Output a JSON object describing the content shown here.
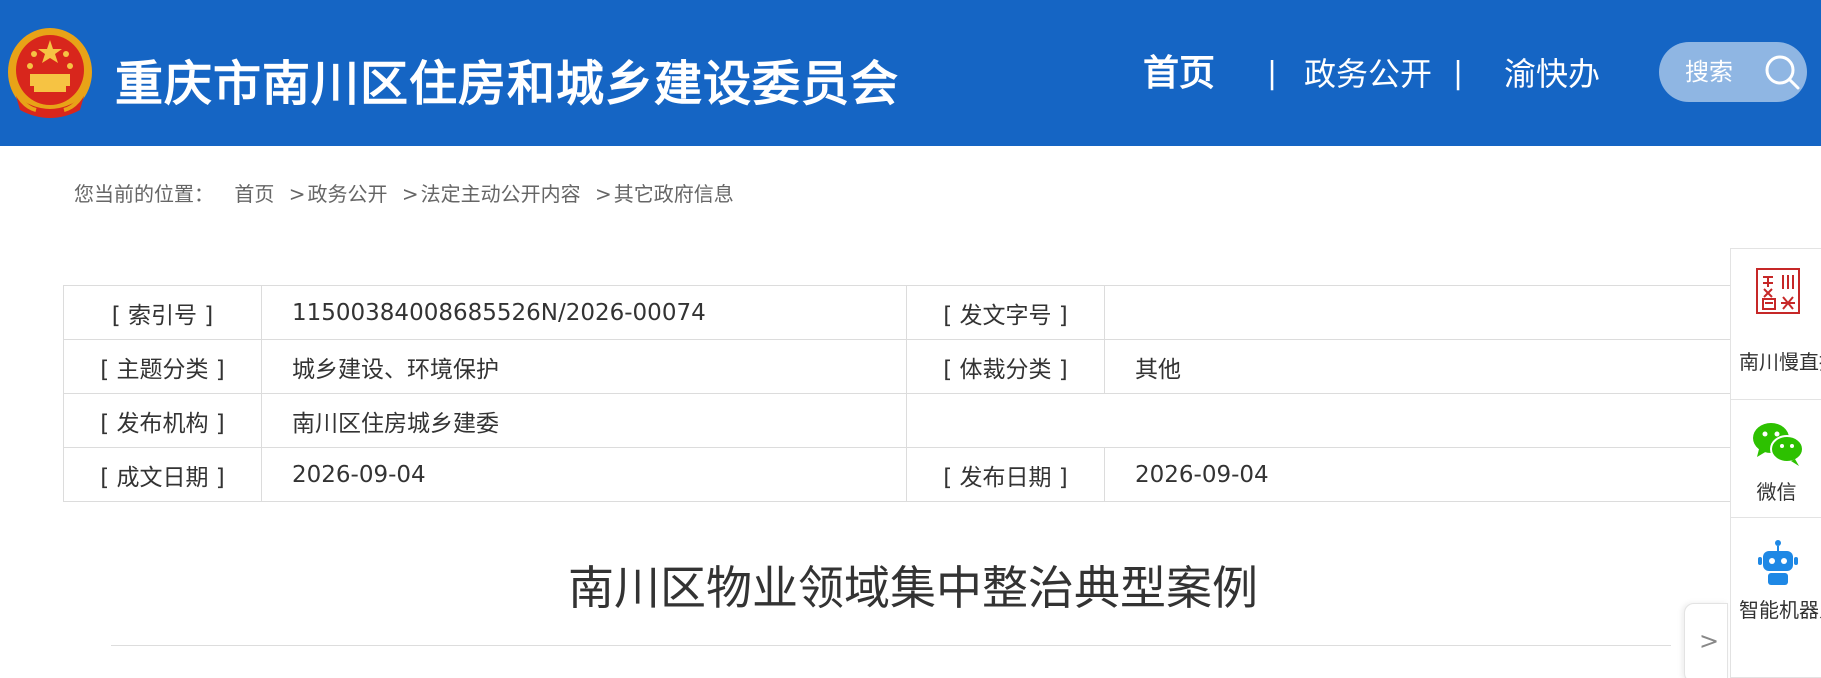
{
  "header": {
    "site_title": "重庆市南川区住房和城乡建设委员会",
    "nav": {
      "home": "首页",
      "separator": "|",
      "gov_open": "政务公开",
      "yukuaiban": "渝快办"
    },
    "search_label": "搜索",
    "colors": {
      "bar": "#1565c4",
      "search_pill": "#8fb6e3"
    }
  },
  "breadcrumb": {
    "prefix": "您当前的位置：",
    "items": [
      "首页",
      "政务公开",
      "法定主动公开内容",
      "其它政府信息"
    ],
    "separator": ">"
  },
  "info": {
    "index_label": "[ 索引号 ]",
    "index_value": "11500384008685526N/2026-00074",
    "doc_no_label": "[ 发文字号 ]",
    "doc_no_value": "",
    "topic_label": "[ 主题分类 ]",
    "topic_value": "城乡建设、环境保护",
    "genre_label": "[ 体裁分类 ]",
    "genre_value": "其他",
    "publisher_label": "[ 发布机构 ]",
    "publisher_value": "南川区住房城乡建委",
    "written_date_label": "[ 成文日期 ]",
    "written_date_value": "2026-09-04",
    "publish_date_label": "[ 发布日期 ]",
    "publish_date_value": "2026-09-04"
  },
  "document": {
    "title": "南川区物业领域集中整治典型案例"
  },
  "sidebar": {
    "items": [
      {
        "label": "南川慢直播",
        "icon": "seal-icon"
      },
      {
        "label": "微信",
        "icon": "wechat-icon"
      },
      {
        "label": "智能机器人",
        "icon": "robot-icon"
      }
    ],
    "collapse_glyph": ">"
  }
}
